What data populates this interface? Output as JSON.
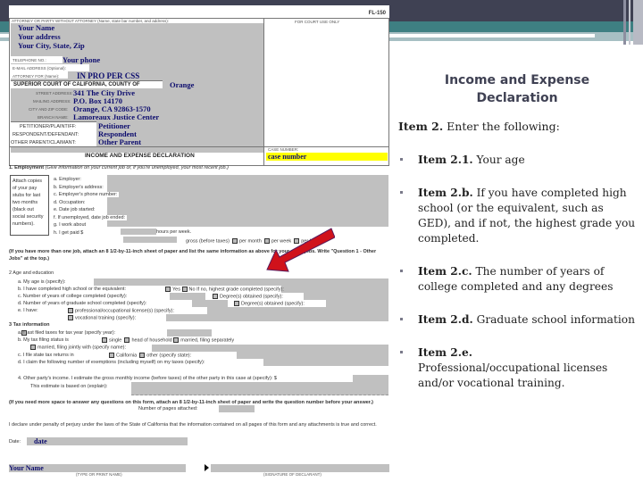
{
  "slide": {
    "title_line1": "Income and Expense",
    "title_line2": "Declaration",
    "intro_bold": "Item 2.",
    "intro_text": " Enter the following:",
    "bullets": [
      {
        "bold": "Item 2.1.",
        "text": " Your age"
      },
      {
        "bold": "Item 2.b.",
        "text": "  If you have completed high school (or the equivalent, such as GED), and if not, the highest grade you completed."
      },
      {
        "bold": "Item 2.c.",
        "text": "  The number of years of college completed and any degrees"
      },
      {
        "bold": "Item 2.d.",
        "text": "  Graduate school information"
      },
      {
        "bold": "Item 2.e.",
        "text": " Professional/occupational  licenses and/or vocational training."
      }
    ],
    "colors": {
      "dark_bar": "#3f4153",
      "teal_bar": "#3e7f82",
      "arrow": "#d0121b",
      "highlight": "#ffff00"
    }
  },
  "form": {
    "form_number": "FL-150",
    "attorney_label": "ATTORNEY OR PARTY WITHOUT ATTORNEY (Name, state bar number, and address):",
    "court_use_label": "FOR COURT USE ONLY",
    "name": "Your Name",
    "address": "Your address",
    "city": "Your City, State, Zip",
    "telephone_label": "TELEPHONE NO.:",
    "phone": "Your phone",
    "email_label": "E-MAIL ADDRESS (Optional):",
    "attorney_for_label": "ATTORNEY FOR (Name):",
    "attorney_for": "IN PRO PER    CSS",
    "court_label": "SUPERIOR COURT OF CALIFORNIA, COUNTY OF",
    "county": "Orange",
    "street_label": "STREET ADDRESS:",
    "street": "341 The City Drive",
    "mailing_label": "MAILING ADDRESS:",
    "mailing": "P.O. Box 14170",
    "city_zip_label": "CITY AND ZIP CODE:",
    "city_zip": "Orange, CA 92863-1570",
    "branch_label": "BRANCH NAME:",
    "branch": "Lamoreaux Justice Center",
    "petitioner_label": "PETITIONER/PLAINTIFF:",
    "petitioner": "Petitioner",
    "respondent_label": "RESPONDENT/DEFENDANT:",
    "respondent": "Respondent",
    "other_label": "OTHER PARENT/CLAIMANT:",
    "other": "Other Parent",
    "form_title": "INCOME AND EXPENSE DECLARATION",
    "case_number_label": "CASE NUMBER:",
    "case_number": "case number",
    "employment_heading": "1.    Employment",
    "employment_note": "(Give information on your current job or, if you're unemployed, your most recent job.)",
    "attach_note": "Attach copies of your pay stubs for last two months (black out social security numbers).",
    "employment_items": [
      "a.   Employer:",
      "b.   Employer's address:",
      "c.   Employer's phone number:",
      "d.   Occupation:",
      "e.   Date job started:",
      "f.    If unemployed, date job ended:",
      "g.   I work about",
      "h.   I get paid $"
    ],
    "hours_per_week": "hours per week.",
    "gross": "gross (before taxes)",
    "per_month": "per month",
    "per_week": "per week",
    "per_hour": "per hour.",
    "more_jobs_note": "(If you have more than one job, attach an 8 1/2-by-11-inch sheet of paper and list the same information as above for your other jobs. Write \"Question 1 - Other Jobs\" at the top.)",
    "age_heading": "2    Age and education",
    "age_items": [
      "a.   My age is (specify):",
      "b.   I have completed high school or the equivalent:",
      "c.   Number of years of college completed (specify):",
      "d.   Number of years of graduate school completed (specify):",
      "e.   I have:"
    ],
    "yes": "Yes",
    "no_text": "No   If no, highest grade completed (specify):",
    "degrees": "Degree(s) obtained (specify):",
    "prof_license": "professional/occupational license(s) (specify):",
    "vocational": "vocational training (specify):",
    "tax_heading": "3    Tax information",
    "tax_items": [
      "a.        I last filed taxes for tax year (specify year):",
      "b.   My tax filing status is",
      "c.   I file state tax returns in",
      "d.   I claim the following number of exemptions (including myself) on my taxes (specify):"
    ],
    "single": "single",
    "head_household": "head of household",
    "married_sep": "married, filing separately",
    "married_joint": "married, filing jointly with (specify name):",
    "california": "California",
    "other_state": "other (specify state):",
    "other_income": "4.   Other party's income. I estimate the gross monthly income (before taxes) of the other party in this case at (specify): $",
    "estimate_basis": "This estimate is based on (explain):",
    "more_space": "(If you need more space to answer any questions on this form, attach an 8 1/2-by-11-inch sheet of paper and write the question number before your answer.)",
    "pages_attached": "Number of pages attached:",
    "declaration": "I declare under penalty of perjury under the laws of the State of California that the information contained on all pages of this form and any attachments is true and correct.",
    "date_label": "Date:",
    "date": "date",
    "sign_name": "Your Name",
    "type_name_label": "(TYPE OR PRINT NAME)",
    "signature_label": "(SIGNATURE OF DECLARANT)"
  }
}
